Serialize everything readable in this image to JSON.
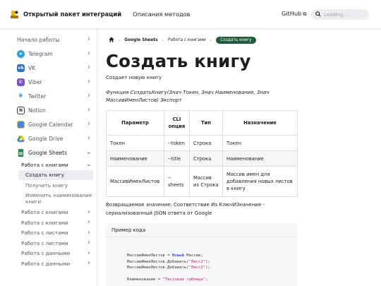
{
  "navbar": {
    "title": "Открытый пакет интеграций",
    "methods_link": "Описания методов",
    "github_label": "GitHub",
    "search_placeholder": "Loading..."
  },
  "sidebar": {
    "items": [
      {
        "label": "Начало работы",
        "icon": "none",
        "color": ""
      },
      {
        "label": "Telegram",
        "icon": "telegram-icon",
        "color": "#2aa3df"
      },
      {
        "label": "VK",
        "icon": "vk-icon",
        "color": "#2a6fd6"
      },
      {
        "label": "Viber",
        "icon": "viber-icon",
        "color": "#7d52c8"
      },
      {
        "label": "Twitter",
        "icon": "twitter-icon",
        "color": "#1d9bf0"
      },
      {
        "label": "Notion",
        "icon": "notion-icon",
        "color": "#333333"
      },
      {
        "label": "Google Calendar",
        "icon": "google-calendar-icon",
        "color": "#4285f4"
      },
      {
        "label": "Google Drive",
        "icon": "google-drive-icon",
        "color": "#34a853"
      },
      {
        "label": "Google Sheets",
        "icon": "google-sheets-icon",
        "color": "#1e8e3e"
      }
    ],
    "sub": {
      "category": "Работа с книгами",
      "children": [
        "Создать книгу",
        "Получить книгу",
        "Изменить наименование книги"
      ],
      "more": [
        "Работа с книгами",
        "Работа с книгами",
        "Работа с листами",
        "Работа с листами",
        "Работа с данными",
        "Работа с данными"
      ]
    }
  },
  "breadcrumbs": {
    "items": [
      "Google Sheets",
      "Работа с книгами"
    ],
    "current": "Создать книгу"
  },
  "page": {
    "title": "Создать книгу",
    "description": "Создает новую книгу",
    "signature": "Функция СоздатьКнигу(Знач Токен, Знач Наименование, Знач МассивИменЛистов) Экспорт",
    "return_text": "Возвращаемое значение: Соответствие Из КлючИЗначение - сериализованный JSON ответа от Google"
  },
  "table": {
    "headers": [
      "Параметр",
      "CLI опция",
      "Тип",
      "Назначение"
    ],
    "rows": [
      [
        "Токен",
        "--token",
        "Строка",
        "Токен"
      ],
      [
        "Наименование",
        "--title",
        "Строка",
        "Наименование"
      ],
      [
        "МассивИменЛистов",
        "--sheets",
        "Массив из Строка",
        "Массив имен для добавления новых листов в книгу"
      ]
    ]
  },
  "code": {
    "title": "Пример кода",
    "line1_a": "МассивИменЛистов = ",
    "line1_kw": "Новый",
    "line1_b": " Массив;",
    "line2_a": "МассивИменЛистов.Добавить(",
    "line2_str": "\"Лист1\"",
    "line2_b": ");",
    "line3_a": "МассивИменЛистов.Добавить(",
    "line3_str": "\"Лист2\"",
    "line3_b": ");",
    "line4_a": "Наименование = ",
    "line4_str": "\"Тестовая таблица\"",
    "line4_b": ";"
  }
}
